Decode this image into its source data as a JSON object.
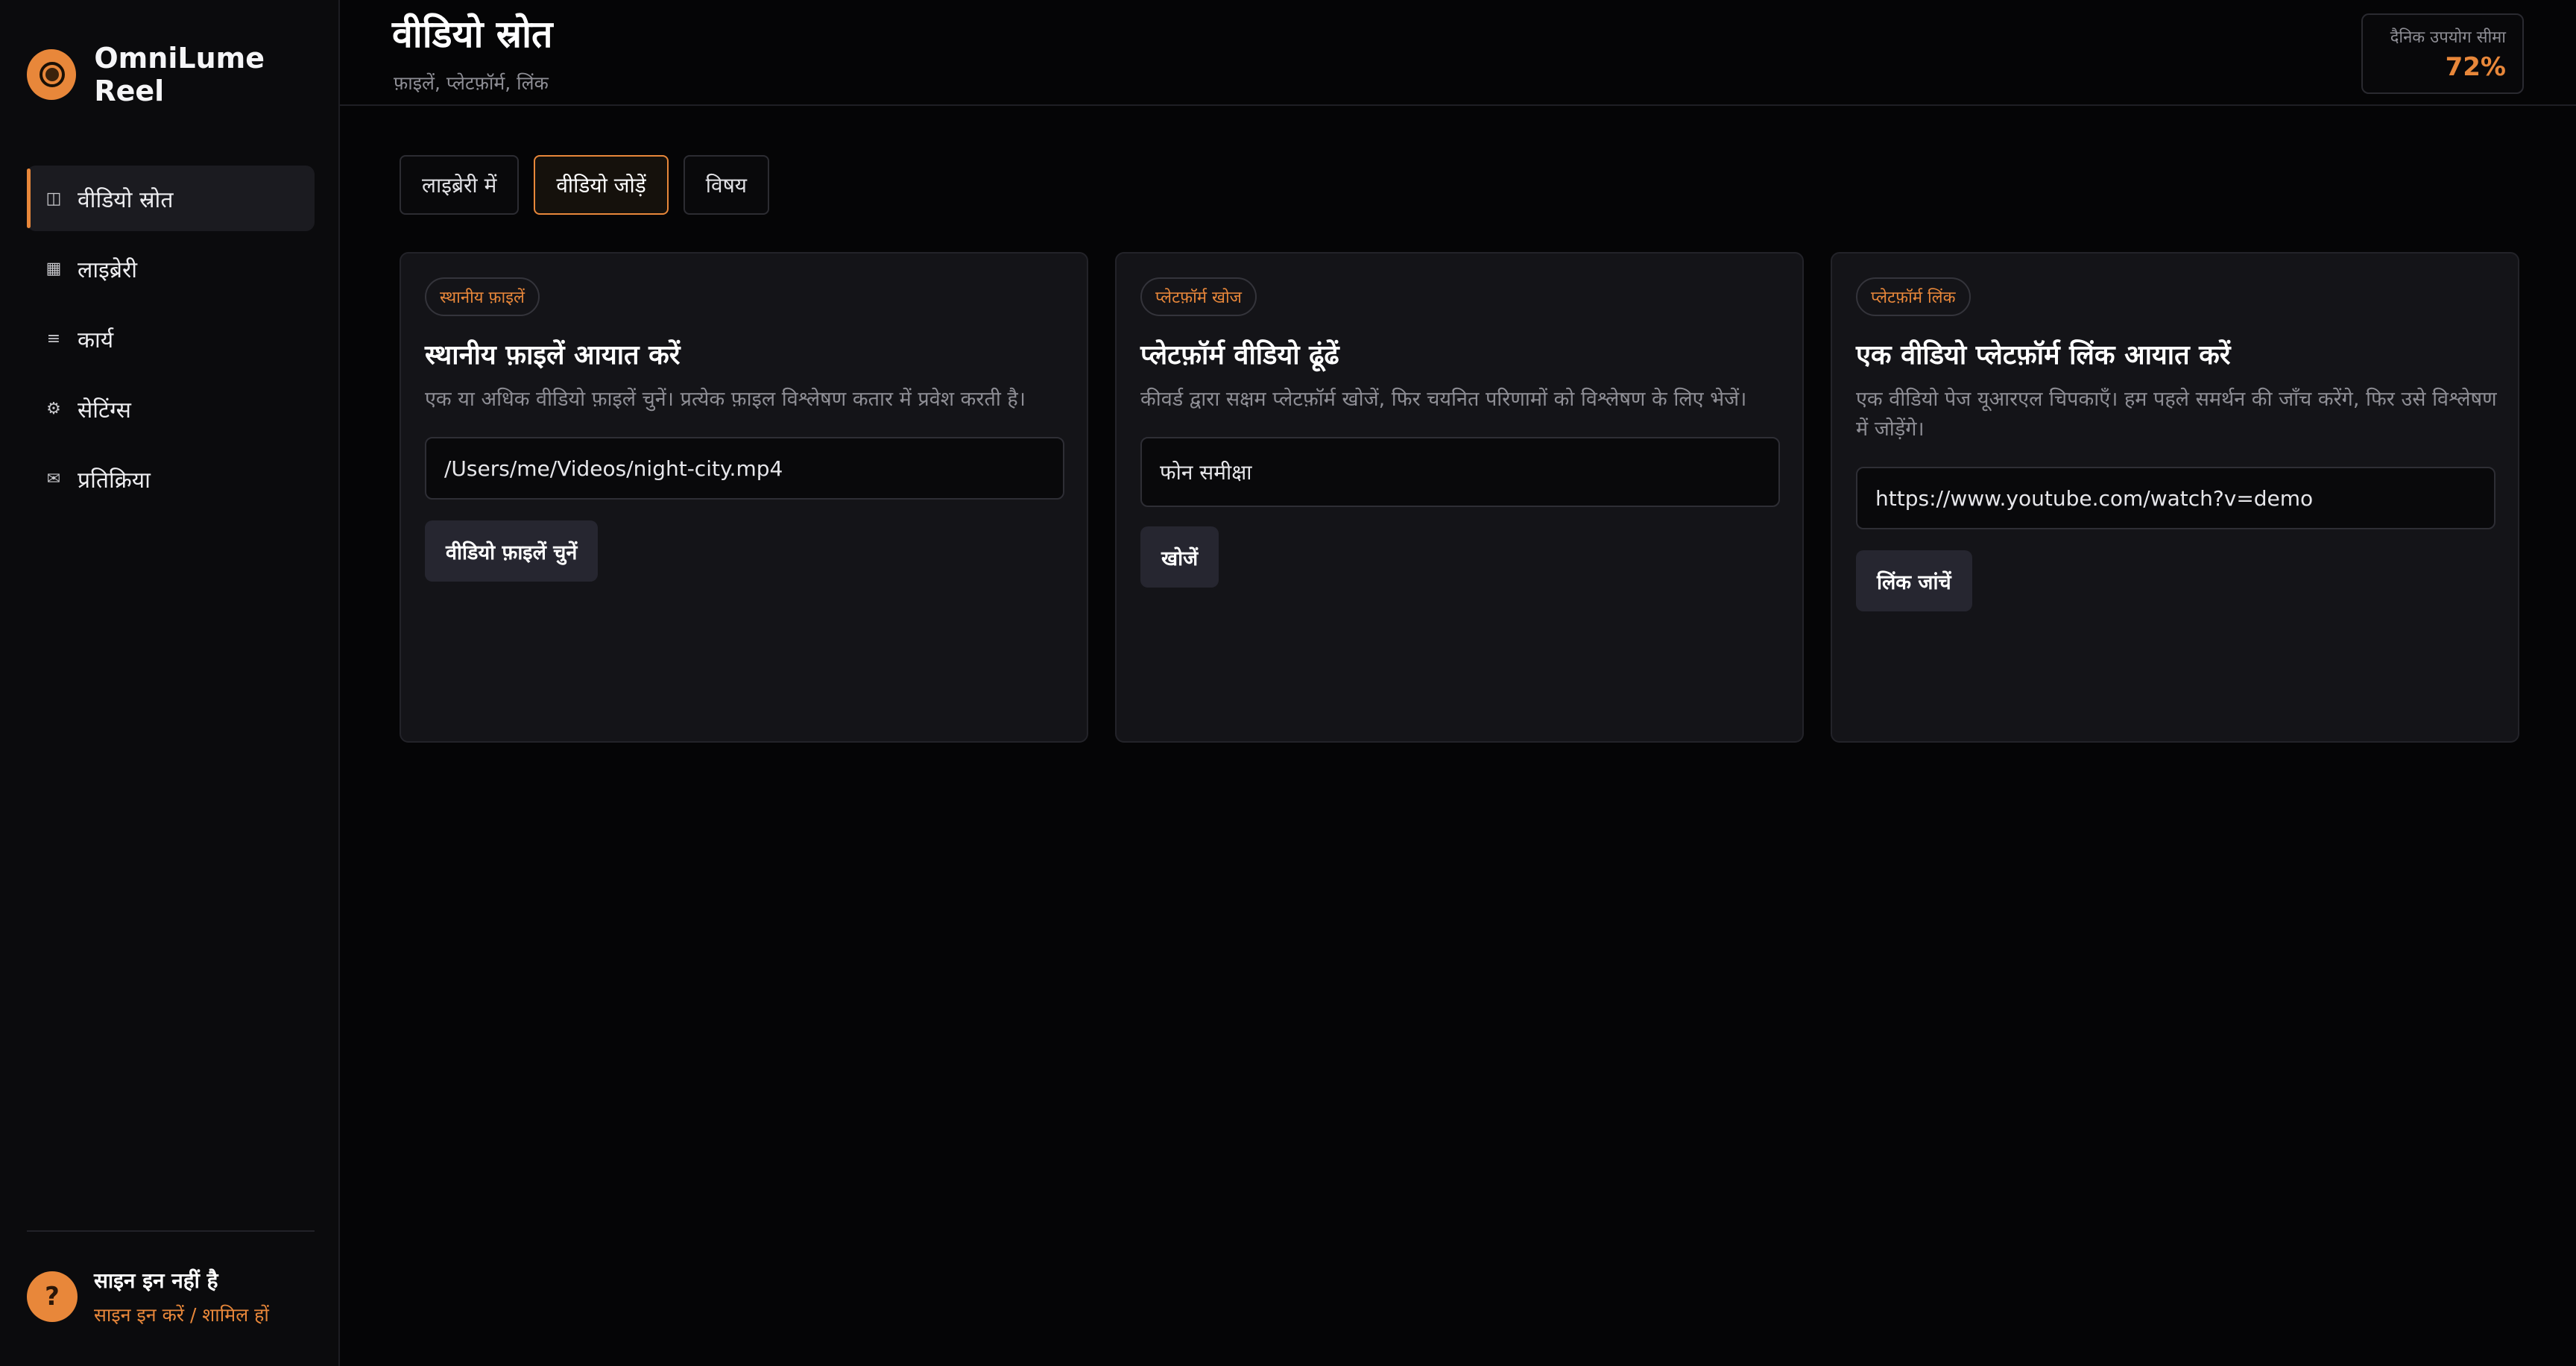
{
  "app": {
    "name": "OmniLume Reel"
  },
  "sidebar": {
    "items": [
      {
        "label": "वीडियो स्रोत",
        "icon": "columns-icon",
        "glyph": "◫"
      },
      {
        "label": "लाइब्रेरी",
        "icon": "library-icon",
        "glyph": "▦"
      },
      {
        "label": "कार्य",
        "icon": "list-icon",
        "glyph": "≡"
      },
      {
        "label": "सेटिंग्स",
        "icon": "gear-icon",
        "glyph": "⚙"
      },
      {
        "label": "प्रतिक्रिया",
        "icon": "mail-icon",
        "glyph": "✉"
      }
    ],
    "active_index": 0
  },
  "user": {
    "avatar": "?",
    "name": "साइन इन नहीं है",
    "action": "साइन इन करें / शामिल हों"
  },
  "header": {
    "title": "वीडियो स्रोत",
    "subtitle": "फ़ाइलें, प्लेटफ़ॉर्म, लिंक"
  },
  "usage": {
    "label": "दैनिक उपयोग सीमा",
    "value": "72%",
    "percent": 72
  },
  "tabs": [
    {
      "label": "लाइब्रेरी में"
    },
    {
      "label": "वीडियो जोड़ें"
    },
    {
      "label": "विषय"
    }
  ],
  "active_tab": 1,
  "cards": [
    {
      "badge": "स्थानीय फ़ाइलें",
      "title": "स्थानीय फ़ाइलें आयात करें",
      "description": "एक या अधिक वीडियो फ़ाइलें चुनें। प्रत्येक फ़ाइल विश्लेषण कतार में प्रवेश करती है।",
      "input_value": "/Users/me/Videos/night-city.mp4",
      "button": "वीडियो फ़ाइलें चुनें"
    },
    {
      "badge": "प्लेटफ़ॉर्म खोज",
      "title": "प्लेटफ़ॉर्म वीडियो ढूंढें",
      "description": "कीवर्ड द्वारा सक्षम प्लेटफ़ॉर्म खोजें, फिर चयनित परिणामों को विश्लेषण के लिए भेजें।",
      "input_value": "फोन समीक्षा",
      "button": "खोजें"
    },
    {
      "badge": "प्लेटफ़ॉर्म लिंक",
      "title": "एक वीडियो प्लेटफ़ॉर्म लिंक आयात करें",
      "description": "एक वीडियो पेज यूआरएल चिपकाएँ। हम पहले समर्थन की जाँच करेंगे, फिर उसे विश्लेषण में जोड़ेंगे।",
      "input_value": "https://www.youtube.com/watch?v=demo",
      "button": "लिंक जांचें"
    }
  ],
  "colors": {
    "accent": "#e8873a",
    "background": "#050506",
    "sidebar": "#0b0b0d",
    "card": "#141418"
  }
}
